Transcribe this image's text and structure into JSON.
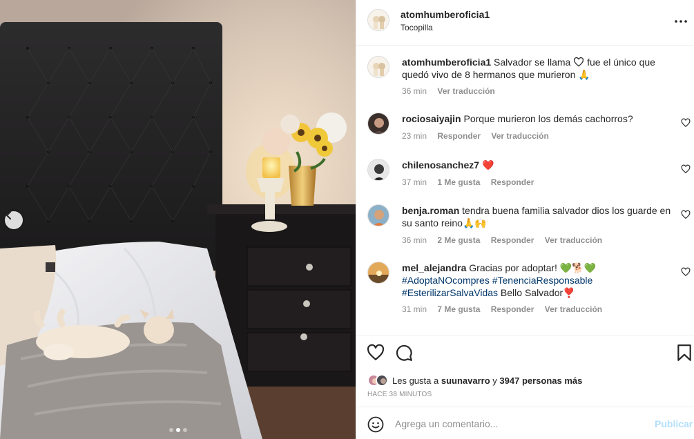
{
  "post": {
    "username": "atomhumberoficia1",
    "location": "Tocopilla",
    "carousel_dots": 3,
    "carousel_active": 1
  },
  "caption": {
    "username": "atomhumberoficia1",
    "text_before_icon": "Salvador se llama",
    "text_after_icon": "fue el único que quedó vivo de 8 hermanos que murieron 🙏",
    "time": "36 min",
    "translate": "Ver traducción"
  },
  "comments": [
    {
      "username": "rociosaiyajin",
      "text": "Porque murieron los demás cachorros?",
      "time": "23 min",
      "reply": "Responder",
      "translate": "Ver traducción"
    },
    {
      "username": "chilenosanchez7",
      "text": "❤️",
      "time": "37 min",
      "likes": "1 Me gusta",
      "reply": "Responder"
    },
    {
      "username": "benja.roman",
      "text": "tendra buena familia salvador dios los guarde en su santo reino🙏🙌",
      "time": "36 min",
      "likes": "2 Me gusta",
      "reply": "Responder",
      "translate": "Ver traducción"
    },
    {
      "username": "mel_alejandra",
      "text_before": "Gracias por adoptar! 💚🐕💚",
      "hashtag1": "#AdoptaNOcompres",
      "hashtag2": "#TenenciaResponsable",
      "hashtag3": "#EsterilizarSalvaVidas",
      "text_after": "Bello Salvador❣️",
      "time": "31 min",
      "likes": "7 Me gusta",
      "reply": "Responder",
      "translate": "Ver traducción"
    }
  ],
  "likes_summary": {
    "prefix": "Les gusta a",
    "user": "suunavarro",
    "middle": "y",
    "others": "3947 personas más"
  },
  "posted_ago": "HACE 38 MINUTOS",
  "composer": {
    "placeholder": "Agrega un comentario...",
    "publish": "Publicar"
  },
  "icons": [
    "more-options-icon",
    "heart-icon",
    "comment-icon",
    "bookmark-icon",
    "emoji-icon",
    "chevron-left-icon"
  ],
  "colors": {
    "text": "#262626",
    "secondary": "#8e8e8e",
    "hashtag": "#00376b",
    "publish_disabled": "#b2dffc",
    "divider": "#efefef"
  }
}
